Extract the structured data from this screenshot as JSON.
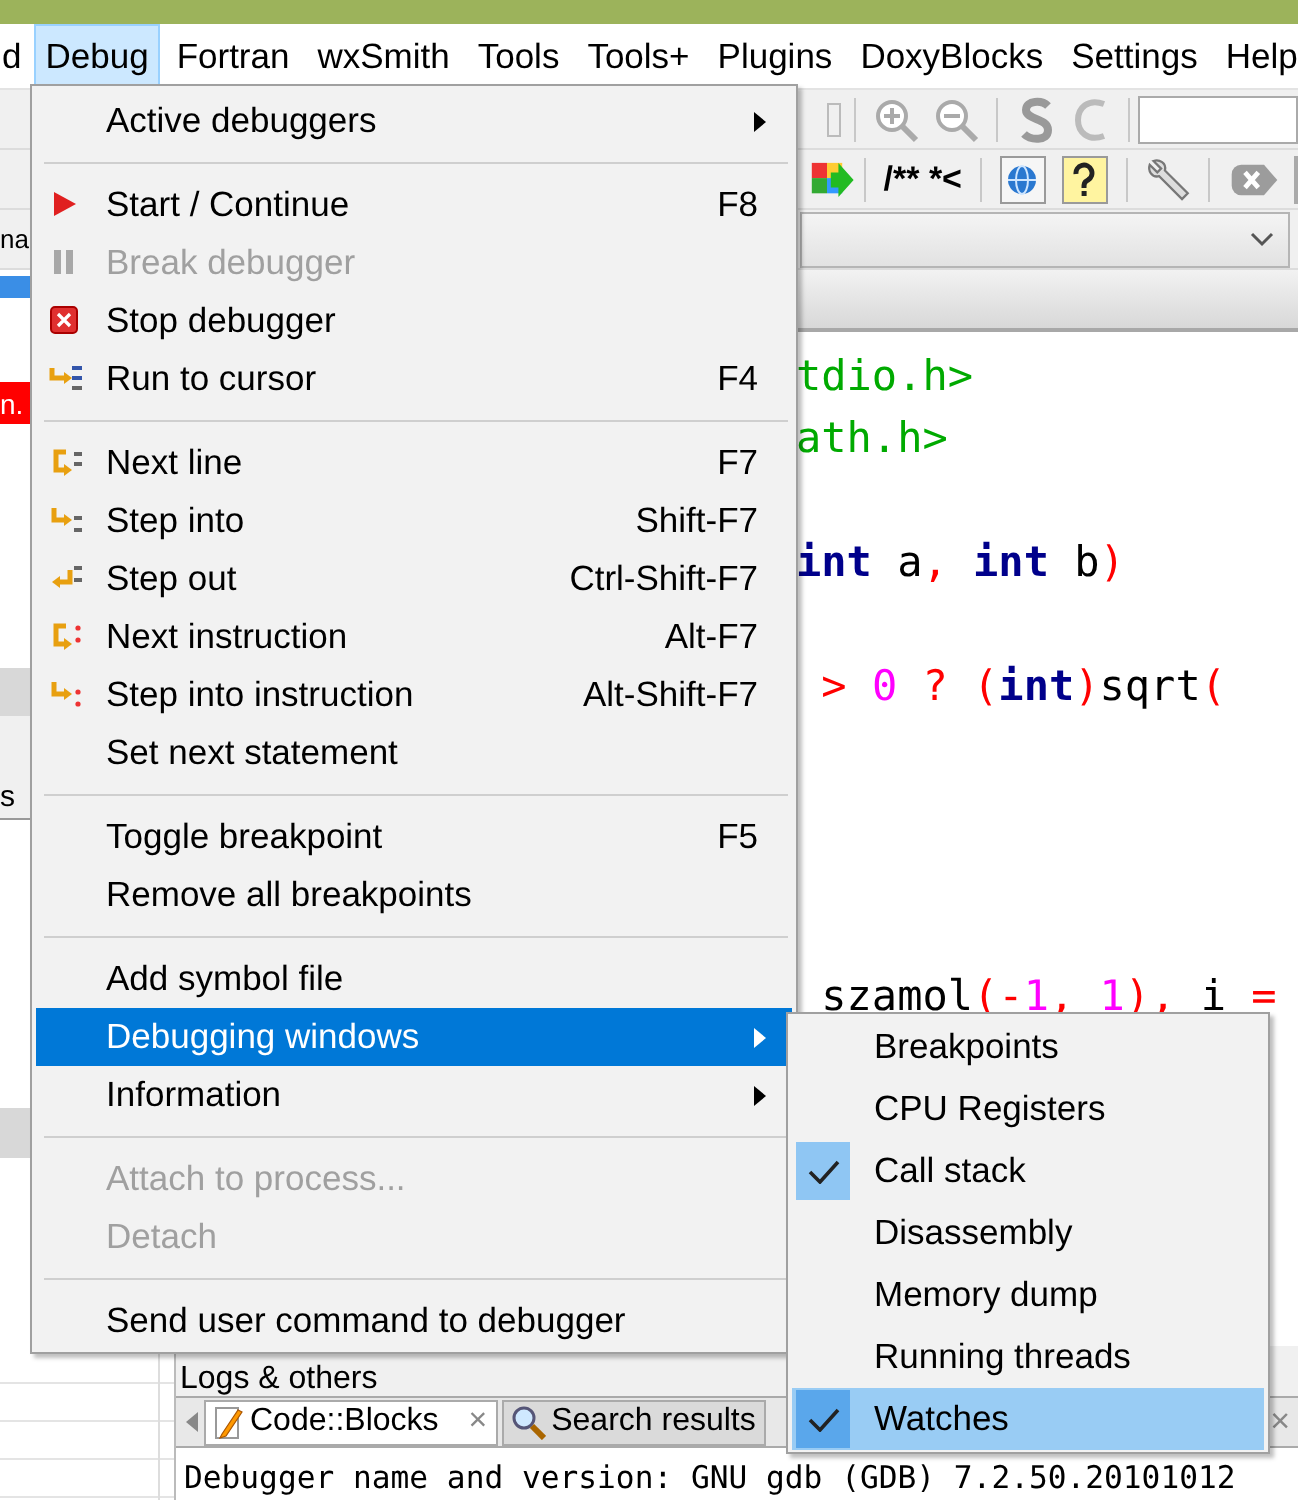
{
  "menu_bar": [
    {
      "label": "d",
      "selected": false
    },
    {
      "label": "Debug",
      "selected": true
    },
    {
      "label": "Fortran",
      "selected": false
    },
    {
      "label": "wxSmith",
      "selected": false
    },
    {
      "label": "Tools",
      "selected": false
    },
    {
      "label": "Tools+",
      "selected": false
    },
    {
      "label": "Plugins",
      "selected": false
    },
    {
      "label": "DoxyBlocks",
      "selected": false
    },
    {
      "label": "Settings",
      "selected": false
    },
    {
      "label": "Help",
      "selected": false
    }
  ],
  "toolbar": {
    "comment_button": "/** *<"
  },
  "left_panel": {
    "tab_label": "na",
    "file_label": "n.",
    "section_label": "s"
  },
  "editor": {
    "lines": [
      {
        "kind": "code",
        "tokens": [
          {
            "text": "tdio.h>",
            "kind": "string"
          }
        ]
      },
      {
        "kind": "code",
        "tokens": [
          {
            "text": "ath.h>",
            "kind": "string"
          }
        ]
      },
      {
        "kind": "blank"
      },
      {
        "kind": "code",
        "tokens": [
          {
            "text": "int",
            "kind": "keyword"
          },
          {
            "text": " a",
            "kind": "plain"
          },
          {
            "text": ", ",
            "kind": "operator"
          },
          {
            "text": "int",
            "kind": "keyword"
          },
          {
            "text": " b",
            "kind": "plain"
          },
          {
            "text": ")",
            "kind": "operator"
          }
        ]
      },
      {
        "kind": "blank"
      },
      {
        "kind": "code",
        "tokens": [
          {
            "text": " > ",
            "kind": "operator"
          },
          {
            "text": "0",
            "kind": "number"
          },
          {
            "text": " ? (",
            "kind": "operator"
          },
          {
            "text": "int",
            "kind": "keyword"
          },
          {
            "text": ")",
            "kind": "operator"
          },
          {
            "text": "sqrt",
            "kind": "plain"
          },
          {
            "text": "(",
            "kind": "operator"
          }
        ]
      },
      {
        "kind": "blank"
      },
      {
        "kind": "blank"
      },
      {
        "kind": "blank"
      },
      {
        "kind": "blank"
      },
      {
        "kind": "code",
        "tokens": [
          {
            "text": " szamol",
            "kind": "plain"
          },
          {
            "text": "(-",
            "kind": "operator"
          },
          {
            "text": "1",
            "kind": "number"
          },
          {
            "text": ", ",
            "kind": "operator"
          },
          {
            "text": "1",
            "kind": "number"
          },
          {
            "text": "),",
            "kind": "operator"
          },
          {
            "text": " i ",
            "kind": "plain"
          },
          {
            "text": "=",
            "kind": "operator"
          }
        ]
      }
    ]
  },
  "logs": {
    "title": "Logs & others",
    "tabs": [
      {
        "label": "Code::Blocks",
        "selected": true
      },
      {
        "label": "Search results",
        "selected": false
      }
    ],
    "close_mark": "×",
    "output": "Debugger name and version: GNU gdb (GDB) 7.2.50.20101012"
  },
  "debug_menu": {
    "items": [
      {
        "kind": "item",
        "label": "Active debuggers",
        "submenu": true,
        "disabled": false,
        "selected": false
      },
      {
        "kind": "separator"
      },
      {
        "kind": "item",
        "label": "Start / Continue",
        "shortcut": "F8",
        "submenu": false,
        "disabled": false,
        "selected": false
      },
      {
        "kind": "item",
        "label": "Break debugger",
        "submenu": false,
        "disabled": true,
        "selected": false
      },
      {
        "kind": "item",
        "label": "Stop debugger",
        "submenu": false,
        "disabled": false,
        "selected": false
      },
      {
        "kind": "item",
        "label": "Run to cursor",
        "shortcut": "F4",
        "submenu": false,
        "disabled": false,
        "selected": false
      },
      {
        "kind": "separator"
      },
      {
        "kind": "item",
        "label": "Next line",
        "shortcut": "F7",
        "submenu": false,
        "disabled": false,
        "selected": false
      },
      {
        "kind": "item",
        "label": "Step into",
        "shortcut": "Shift-F7",
        "submenu": false,
        "disabled": false,
        "selected": false
      },
      {
        "kind": "item",
        "label": "Step out",
        "shortcut": "Ctrl-Shift-F7",
        "submenu": false,
        "disabled": false,
        "selected": false
      },
      {
        "kind": "item",
        "label": "Next instruction",
        "shortcut": "Alt-F7",
        "submenu": false,
        "disabled": false,
        "selected": false
      },
      {
        "kind": "item",
        "label": "Step into instruction",
        "shortcut": "Alt-Shift-F7",
        "submenu": false,
        "disabled": false,
        "selected": false
      },
      {
        "kind": "item",
        "label": "Set next statement",
        "submenu": false,
        "disabled": false,
        "selected": false
      },
      {
        "kind": "separator"
      },
      {
        "kind": "item",
        "label": "Toggle breakpoint",
        "shortcut": "F5",
        "submenu": false,
        "disabled": false,
        "selected": false
      },
      {
        "kind": "item",
        "label": "Remove all breakpoints",
        "submenu": false,
        "disabled": false,
        "selected": false
      },
      {
        "kind": "separator"
      },
      {
        "kind": "item",
        "label": "Add symbol file",
        "submenu": false,
        "disabled": false,
        "selected": false
      },
      {
        "kind": "item",
        "label": "Debugging windows",
        "submenu": true,
        "disabled": false,
        "selected": true
      },
      {
        "kind": "item",
        "label": "Information",
        "submenu": true,
        "disabled": false,
        "selected": false
      },
      {
        "kind": "separator"
      },
      {
        "kind": "item",
        "label": "Attach to process...",
        "submenu": false,
        "disabled": true,
        "selected": false
      },
      {
        "kind": "item",
        "label": "Detach",
        "submenu": false,
        "disabled": true,
        "selected": false
      },
      {
        "kind": "separator"
      },
      {
        "kind": "item",
        "label": "Send user command to debugger",
        "submenu": false,
        "disabled": false,
        "selected": false
      }
    ]
  },
  "submenu": {
    "items": [
      {
        "label": "Breakpoints",
        "checked": false,
        "selected": false
      },
      {
        "label": "CPU Registers",
        "checked": false,
        "selected": false
      },
      {
        "label": "Call stack",
        "checked": true,
        "selected": false
      },
      {
        "label": "Disassembly",
        "checked": false,
        "selected": false
      },
      {
        "label": "Memory dump",
        "checked": false,
        "selected": false
      },
      {
        "label": "Running threads",
        "checked": false,
        "selected": false
      },
      {
        "label": "Watches",
        "checked": true,
        "selected": true
      }
    ]
  }
}
